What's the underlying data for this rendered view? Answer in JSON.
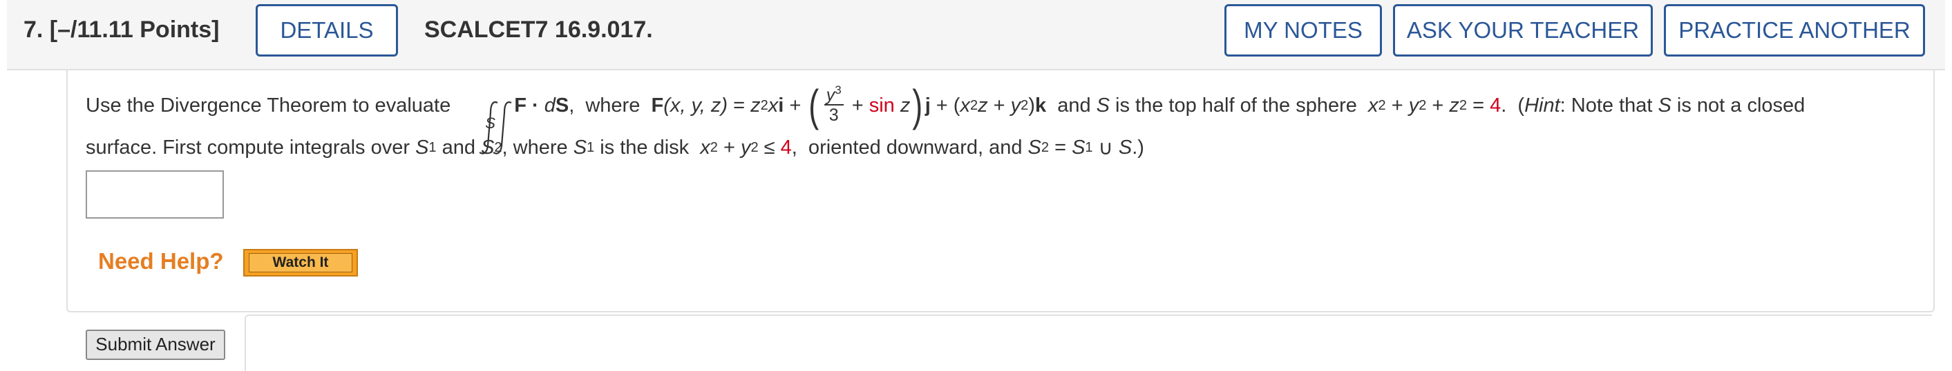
{
  "header": {
    "question_number": "7.  [–/11.11 Points]",
    "details_label": "DETAILS",
    "question_id": "SCALCET7 16.9.017.",
    "my_notes_label": "MY NOTES",
    "ask_teacher_label": "ASK YOUR TEACHER",
    "practice_label": "PRACTICE ANOTHER"
  },
  "question": {
    "line1": {
      "intro": "Use the Divergence Theorem to evaluate",
      "integral_subscript": "S",
      "f_dot": "F · ",
      "ds_d": "d",
      "ds_S": "S",
      "where1": ",  where  ",
      "F": "F",
      "args": "(x, y, z)",
      "eq": " = ",
      "z": "z",
      "sq": "2",
      "xi": "x",
      "i": "i",
      "plus1": " + ",
      "frac_num_y": "y",
      "frac_num_exp": "3",
      "frac_den": "3",
      "plus2": " + ",
      "sin": "sin",
      "z2": " z",
      "j": "j",
      "plus3": " + (",
      "x2": "x",
      "x2exp": "2",
      "z3": "z",
      "plus4": " + ",
      "y2": "y",
      "y2exp": "2",
      "close_k": ")",
      "k": "k",
      "and_S": "  and ",
      "S_it": "S",
      "top_half": " is the top half of the sphere  ",
      "sx": "x",
      "sx_exp": "2",
      "plus5": " + ",
      "sy": "y",
      "sy_exp": "2",
      "plus6": " + ",
      "sz": "z",
      "sz_exp": "2",
      "eq2": " = ",
      "four": "4",
      "dot": ".  (",
      "hint": "Hint",
      "hint_rest": ": Note that ",
      "S_hint": "S",
      "not_closed": " is not a closed"
    },
    "line2": {
      "surface": "surface. First compute integrals over ",
      "S1": "S",
      "S1_sub": "1",
      "and": " and ",
      "S2": "S",
      "S2_sub": "2",
      "where": ", where ",
      "S1b": "S",
      "S1b_sub": "1",
      "disk": " is the disk  ",
      "dx": "x",
      "dx_exp": "2",
      "plus": " + ",
      "dy": "y",
      "dy_exp": "2",
      "leq": " ≤ ",
      "four": "4",
      "oriented": ",  oriented downward, and ",
      "S2b": "S",
      "S2b_sub": "2",
      "eq": " = ",
      "S1c": "S",
      "S1c_sub": "1",
      "union": " ∪ ",
      "S_end": "S",
      "end": ".)"
    }
  },
  "help": {
    "need_help": "Need Help?",
    "watch_it": "Watch It"
  },
  "submit_label": "Submit Answer",
  "colors": {
    "accent": "#2b5797",
    "highlight_red": "#d0021b",
    "help_orange": "#e67e22"
  }
}
